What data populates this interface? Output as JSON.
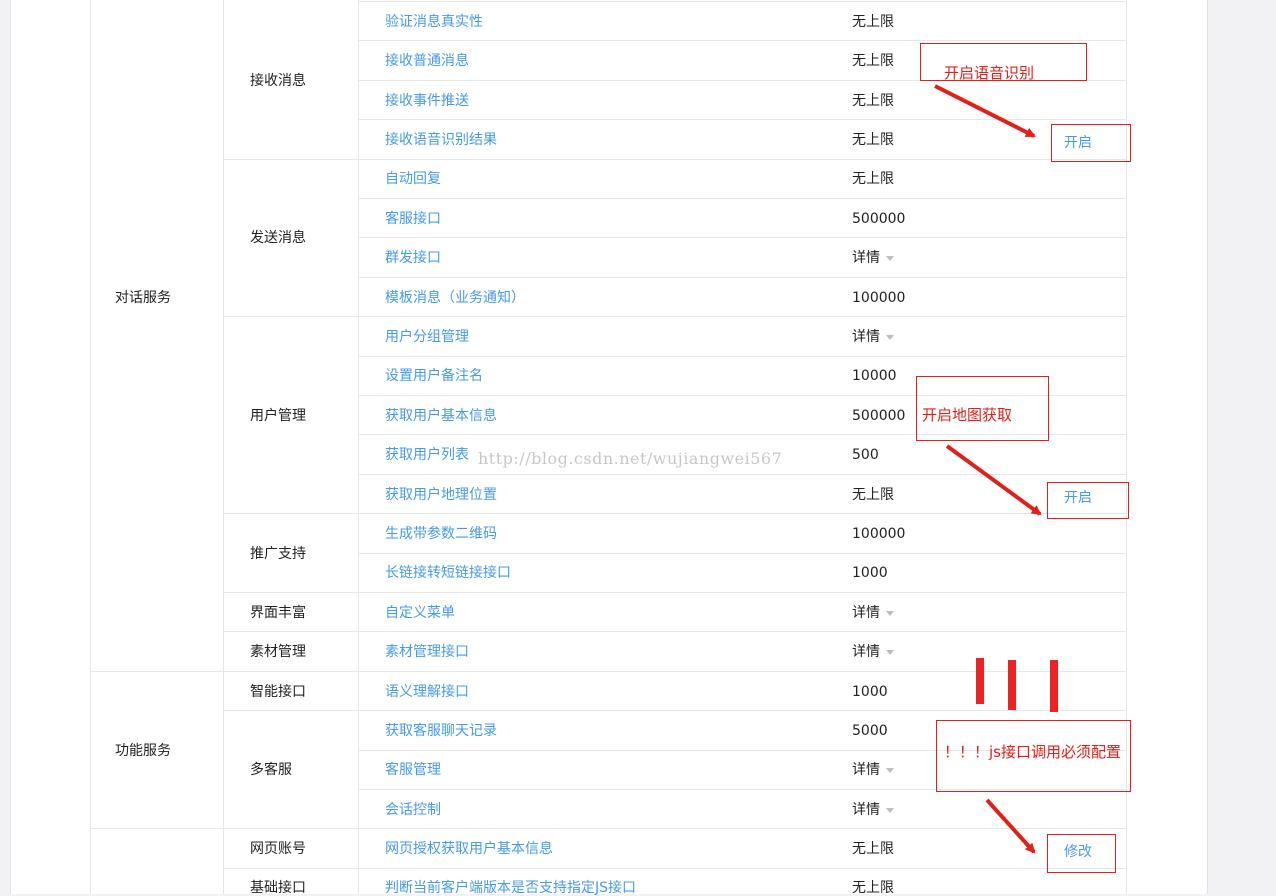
{
  "categories": [
    "对话服务",
    "功能服务"
  ],
  "subgroups": [
    "接收消息",
    "发送消息",
    "用户管理",
    "推广支持",
    "界面丰富",
    "素材管理",
    "智能接口",
    "多客服",
    "网页账号",
    "基础接口"
  ],
  "rows": [
    {
      "name": "验证消息真实性",
      "limit": "无上限"
    },
    {
      "name": "接收普通消息",
      "limit": "无上限"
    },
    {
      "name": "接收事件推送",
      "limit": "无上限"
    },
    {
      "name": "接收语音识别结果",
      "limit": "无上限"
    },
    {
      "name": "自动回复",
      "limit": "无上限"
    },
    {
      "name": "客服接口",
      "limit": "500000"
    },
    {
      "name": "群发接口",
      "limit": "详情"
    },
    {
      "name": "模板消息（业务通知）",
      "limit": "100000"
    },
    {
      "name": "用户分组管理",
      "limit": "详情"
    },
    {
      "name": "设置用户备注名",
      "limit": "10000"
    },
    {
      "name": "获取用户基本信息",
      "limit": "500000"
    },
    {
      "name": "获取用户列表",
      "limit": "500"
    },
    {
      "name": "获取用户地理位置",
      "limit": "无上限"
    },
    {
      "name": "生成带参数二维码",
      "limit": "100000"
    },
    {
      "name": "长链接转短链接接口",
      "limit": "1000"
    },
    {
      "name": "自定义菜单",
      "limit": "详情"
    },
    {
      "name": "素材管理接口",
      "limit": "详情"
    },
    {
      "name": "语义理解接口",
      "limit": "1000"
    },
    {
      "name": "获取客服聊天记录",
      "limit": "5000"
    },
    {
      "name": "客服管理",
      "limit": "详情"
    },
    {
      "name": "会话控制",
      "limit": "详情"
    },
    {
      "name": "网页授权获取用户基本信息",
      "limit": "无上限"
    },
    {
      "name": "判断当前客户端版本是否支持指定JS接口",
      "limit": "无上限"
    }
  ],
  "watermark": "http://blog.csdn.net/wujiangwei567",
  "annotations": {
    "voice_note": "开启语音识别",
    "voice_action": "开启",
    "location_note": "开启地图获取",
    "location_action": "开启",
    "js_note": "！！！js接口调用必须配置",
    "js_action": "修改"
  },
  "colors": {
    "link": "#459ae9",
    "annotation": "#e0201a"
  }
}
